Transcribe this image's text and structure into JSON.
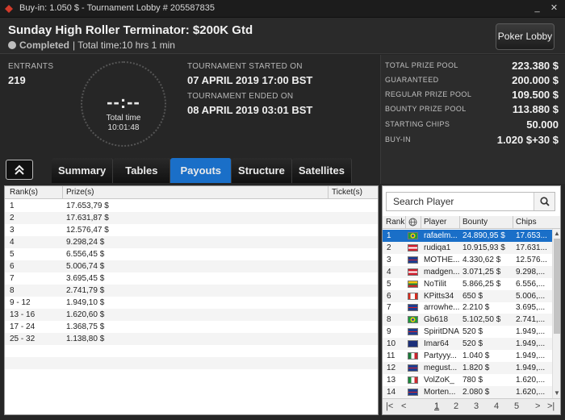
{
  "window": {
    "title": "Buy-in: 1.050 $ - Tournament Lobby # 205587835",
    "minimize_label": "_",
    "close_label": "✕"
  },
  "header": {
    "tournament_name": "Sunday High Roller Terminator: $200K Gtd",
    "status": "Completed",
    "total_time": "| Total time:10 hrs  1 min",
    "lobby_button": "Poker Lobby"
  },
  "info": {
    "entrants_label": "ENTRANTS",
    "entrants_value": "219",
    "clock_digits": "--:--",
    "clock_label": "Total time",
    "clock_value": "10:01:48",
    "started_label": "TOURNAMENT STARTED ON",
    "started_value": "07 APRIL 2019  17:00 BST",
    "ended_label": "TOURNAMENT ENDED ON",
    "ended_value": "08 APRIL 2019  03:01 BST"
  },
  "prize_pool": [
    {
      "label": "TOTAL PRIZE POOL",
      "value": "223.380 $"
    },
    {
      "label": "GUARANTEED",
      "value": "200.000 $"
    },
    {
      "label": "REGULAR PRIZE POOL",
      "value": "109.500 $"
    },
    {
      "label": "BOUNTY PRIZE POOL",
      "value": "113.880 $"
    },
    {
      "label": "STARTING CHIPS",
      "value": "50.000"
    },
    {
      "label": "BUY-IN",
      "value": "1.020 $+30 $"
    }
  ],
  "tabs": [
    {
      "label": "Summary",
      "active": false
    },
    {
      "label": "Tables",
      "active": false
    },
    {
      "label": "Payouts",
      "active": true
    },
    {
      "label": "Structure",
      "active": false
    },
    {
      "label": "Satellites",
      "active": false
    }
  ],
  "payouts": {
    "headers": {
      "rank": "Rank(s)",
      "prize": "Prize(s)",
      "ticket": "Ticket(s)"
    },
    "rows": [
      {
        "rank": "1",
        "prize": "17.653,79 $"
      },
      {
        "rank": "2",
        "prize": "17.631,87 $"
      },
      {
        "rank": "3",
        "prize": "12.576,47 $"
      },
      {
        "rank": "4",
        "prize": "9.298,24 $"
      },
      {
        "rank": "5",
        "prize": "6.556,45 $"
      },
      {
        "rank": "6",
        "prize": "5.006,74 $"
      },
      {
        "rank": "7",
        "prize": "3.695,45 $"
      },
      {
        "rank": "8",
        "prize": "2.741,79 $"
      },
      {
        "rank": "9 - 12",
        "prize": "1.949,10 $"
      },
      {
        "rank": "13 - 16",
        "prize": "1.620,60 $"
      },
      {
        "rank": "17 - 24",
        "prize": "1.368,75 $"
      },
      {
        "rank": "25 - 32",
        "prize": "1.138,80 $"
      }
    ]
  },
  "players": {
    "search_placeholder": "Search Player",
    "headers": {
      "rank": "Rank",
      "player": "Player",
      "bounty": "Bounty",
      "chips": "Chips"
    },
    "rows": [
      {
        "rank": "1",
        "flag": "brazil-flag",
        "player": "rafaelm...",
        "bounty": "24.890,95 $",
        "chips": "17.653..."
      },
      {
        "rank": "2",
        "flag": "austria-flag",
        "player": "rudiqa1",
        "bounty": "10.915,93 $",
        "chips": "17.631..."
      },
      {
        "rank": "3",
        "flag": "uk-flag",
        "player": "MOTHE...",
        "bounty": "4.330,62 $",
        "chips": "12.576..."
      },
      {
        "rank": "4",
        "flag": "austria-flag",
        "player": "madgen...",
        "bounty": "3.071,25 $",
        "chips": "9.298,..."
      },
      {
        "rank": "5",
        "flag": "lithuania-flag",
        "player": "NoTilit",
        "bounty": "5.866,25 $",
        "chips": "6.556,..."
      },
      {
        "rank": "6",
        "flag": "canada-flag",
        "player": "KPitts34",
        "bounty": "650 $",
        "chips": "5.006,..."
      },
      {
        "rank": "7",
        "flag": "uk-flag",
        "player": "arrowhe...",
        "bounty": "2.210 $",
        "chips": "3.695,..."
      },
      {
        "rank": "8",
        "flag": "brazil-flag",
        "player": "Gb618",
        "bounty": "5.102,50 $",
        "chips": "2.741,..."
      },
      {
        "rank": "9",
        "flag": "uk-flag",
        "player": "SpiritDNA",
        "bounty": "520 $",
        "chips": "1.949,..."
      },
      {
        "rank": "10",
        "flag": "australia-flag",
        "player": "Imar64",
        "bounty": "520 $",
        "chips": "1.949,..."
      },
      {
        "rank": "11",
        "flag": "mexico-flag",
        "player": "Partyyy...",
        "bounty": "1.040 $",
        "chips": "1.949,..."
      },
      {
        "rank": "12",
        "flag": "uk-flag",
        "player": "megust...",
        "bounty": "1.820 $",
        "chips": "1.949,..."
      },
      {
        "rank": "13",
        "flag": "italy-flag",
        "player": "VolZoK_",
        "bounty": "780 $",
        "chips": "1.620,..."
      },
      {
        "rank": "14",
        "flag": "uk-flag",
        "player": "Morten...",
        "bounty": "2.080 $",
        "chips": "1.620,..."
      }
    ],
    "pager": {
      "first": "|<",
      "prev": "<",
      "pages": [
        "1",
        "2",
        "3",
        "4",
        "5"
      ],
      "current": "1",
      "next": ">",
      "last": ">|"
    }
  },
  "colors": {
    "accent": "#1a6fc8",
    "window_bg": "#262626",
    "panel_bg": "#2c2c2c",
    "table_bg": "#ffffff"
  }
}
